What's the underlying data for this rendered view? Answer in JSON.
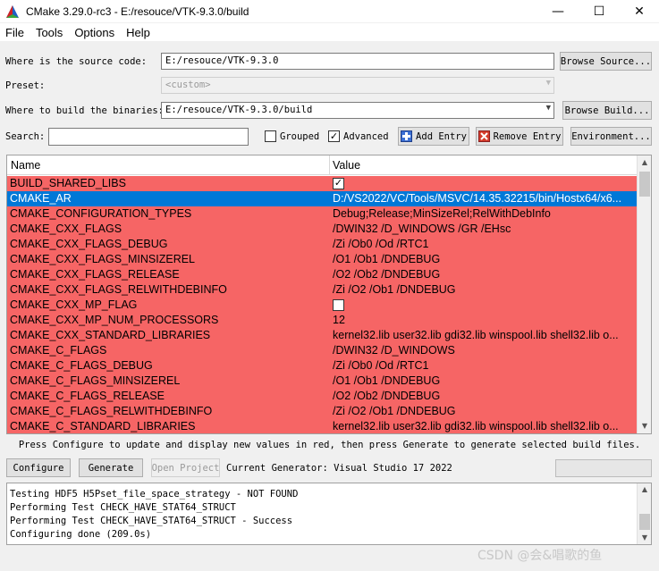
{
  "window": {
    "title": "CMake 3.29.0-rc3 - E:/resouce/VTK-9.3.0/build",
    "minimize": "—",
    "maximize": "☐",
    "close": "✕"
  },
  "menu": [
    "File",
    "Tools",
    "Options",
    "Help"
  ],
  "source": {
    "label": "Where is the source code:",
    "value": "E:/resouce/VTK-9.3.0",
    "browse_label": "Browse Source..."
  },
  "preset": {
    "label": "Preset:",
    "value": "<custom>"
  },
  "build": {
    "label": "Where to build the binaries:",
    "value": "E:/resouce/VTK-9.3.0/build",
    "browse_label": "Browse Build..."
  },
  "search": {
    "label": "Search:",
    "value": "",
    "grouped_label": "Grouped",
    "grouped_checked": false,
    "advanced_label": "Advanced",
    "advanced_checked": true,
    "add_entry_label": "Add Entry",
    "remove_entry_label": "Remove Entry",
    "environment_label": "Environment..."
  },
  "table": {
    "col_name": "Name",
    "col_value": "Value",
    "rows": [
      {
        "name": "BUILD_SHARED_LIBS",
        "type": "bool",
        "checked": true,
        "value": ""
      },
      {
        "name": "CMAKE_AR",
        "type": "text",
        "value": "D:/VS2022/VC/Tools/MSVC/14.35.32215/bin/Hostx64/x6...",
        "selected": true
      },
      {
        "name": "CMAKE_CONFIGURATION_TYPES",
        "type": "text",
        "value": "Debug;Release;MinSizeRel;RelWithDebInfo"
      },
      {
        "name": "CMAKE_CXX_FLAGS",
        "type": "text",
        "value": "/DWIN32 /D_WINDOWS /GR /EHsc"
      },
      {
        "name": "CMAKE_CXX_FLAGS_DEBUG",
        "type": "text",
        "value": "/Zi /Ob0 /Od /RTC1"
      },
      {
        "name": "CMAKE_CXX_FLAGS_MINSIZEREL",
        "type": "text",
        "value": "/O1 /Ob1 /DNDEBUG"
      },
      {
        "name": "CMAKE_CXX_FLAGS_RELEASE",
        "type": "text",
        "value": "/O2 /Ob2 /DNDEBUG"
      },
      {
        "name": "CMAKE_CXX_FLAGS_RELWITHDEBINFO",
        "type": "text",
        "value": "/Zi /O2 /Ob1 /DNDEBUG"
      },
      {
        "name": "CMAKE_CXX_MP_FLAG",
        "type": "bool",
        "checked": false,
        "value": ""
      },
      {
        "name": "CMAKE_CXX_MP_NUM_PROCESSORS",
        "type": "text",
        "value": "12"
      },
      {
        "name": "CMAKE_CXX_STANDARD_LIBRARIES",
        "type": "text",
        "value": "kernel32.lib user32.lib gdi32.lib winspool.lib shell32.lib o..."
      },
      {
        "name": "CMAKE_C_FLAGS",
        "type": "text",
        "value": "/DWIN32 /D_WINDOWS"
      },
      {
        "name": "CMAKE_C_FLAGS_DEBUG",
        "type": "text",
        "value": "/Zi /Ob0 /Od /RTC1"
      },
      {
        "name": "CMAKE_C_FLAGS_MINSIZEREL",
        "type": "text",
        "value": "/O1 /Ob1 /DNDEBUG"
      },
      {
        "name": "CMAKE_C_FLAGS_RELEASE",
        "type": "text",
        "value": "/O2 /Ob2 /DNDEBUG"
      },
      {
        "name": "CMAKE_C_FLAGS_RELWITHDEBINFO",
        "type": "text",
        "value": "/Zi /O2 /Ob1 /DNDEBUG"
      },
      {
        "name": "CMAKE_C_STANDARD_LIBRARIES",
        "type": "text",
        "value": "kernel32.lib user32.lib gdi32.lib winspool.lib shell32.lib o..."
      }
    ]
  },
  "info_text": "Press Configure to update and display new values in red, then press Generate to generate selected build files.",
  "actions": {
    "configure_label": "Configure",
    "generate_label": "Generate",
    "open_project_label": "Open Project",
    "current_generator": "Current Generator: Visual Studio 17 2022"
  },
  "log": [
    "Testing HDF5 H5Pset_file_space_strategy - NOT FOUND",
    "Performing Test CHECK_HAVE_STAT64_STRUCT",
    "Performing Test CHECK_HAVE_STAT64_STRUCT - Success",
    "Configuring done (209.0s)"
  ],
  "watermark": "CSDN @会&唱歌的鱼",
  "colors": {
    "changed_row": "#f66565",
    "selected_row": "#0078d7"
  }
}
